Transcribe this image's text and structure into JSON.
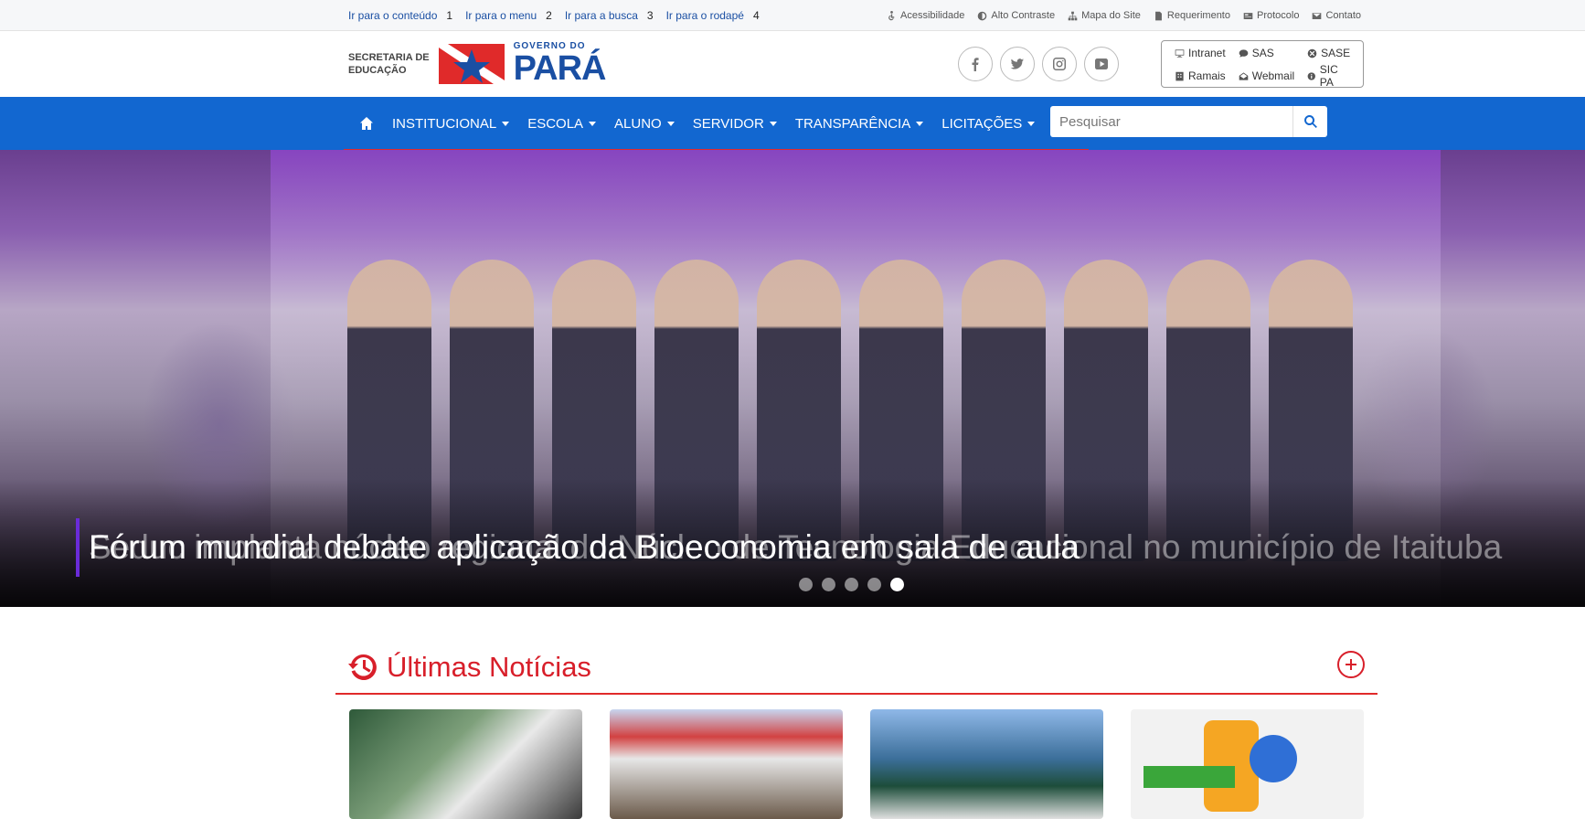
{
  "skip_links": [
    {
      "label": "Ir para o conteúdo",
      "key": "1"
    },
    {
      "label": "Ir para o menu",
      "key": "2"
    },
    {
      "label": "Ir para a busca",
      "key": "3"
    },
    {
      "label": "Ir para o rodapé",
      "key": "4"
    }
  ],
  "tools": [
    {
      "label": "Acessibilidade",
      "icon": "wheelchair-icon"
    },
    {
      "label": "Alto Contraste",
      "icon": "contrast-icon"
    },
    {
      "label": "Mapa do Site",
      "icon": "sitemap-icon"
    },
    {
      "label": "Requerimento",
      "icon": "file-icon"
    },
    {
      "label": "Protocolo",
      "icon": "card-icon"
    },
    {
      "label": "Contato",
      "icon": "envelope-icon"
    }
  ],
  "logo": {
    "secretaria": "SECRETARIA DE",
    "educacao": "EDUCAÇÃO",
    "gov_small": "GOVERNO DO",
    "gov_big": "PARÁ"
  },
  "social": [
    "facebook-icon",
    "twitter-icon",
    "instagram-icon",
    "youtube-icon"
  ],
  "quick_links": [
    {
      "label": "Intranet",
      "icon": "desktop-icon"
    },
    {
      "label": "SAS",
      "icon": "chat-icon"
    },
    {
      "label": "SASE",
      "icon": "x-circle-icon"
    },
    {
      "label": "Ramais",
      "icon": "phone-icon"
    },
    {
      "label": "Webmail",
      "icon": "mail-open-icon"
    },
    {
      "label": "SIC PA",
      "icon": "info-icon"
    }
  ],
  "nav": {
    "items": [
      "INSTITUCIONAL",
      "ESCOLA",
      "ALUNO",
      "SERVIDOR",
      "TRANSPARÊNCIA",
      "LICITAÇÕES"
    ],
    "search_placeholder": "Pesquisar"
  },
  "hero": {
    "caption": "Fórum mundial debate aplicação da Bioeconomia em sala de aula",
    "ghost_caption": "Seduc implanta núcleo regional do Núcleo de Tecnologia Educacional no município de Itaituba",
    "slides": 5,
    "active_slide": 5
  },
  "news": {
    "title": "Últimas Notícias"
  },
  "colors": {
    "nav_blue": "#1267d0",
    "accent_red": "#d81f2a"
  }
}
